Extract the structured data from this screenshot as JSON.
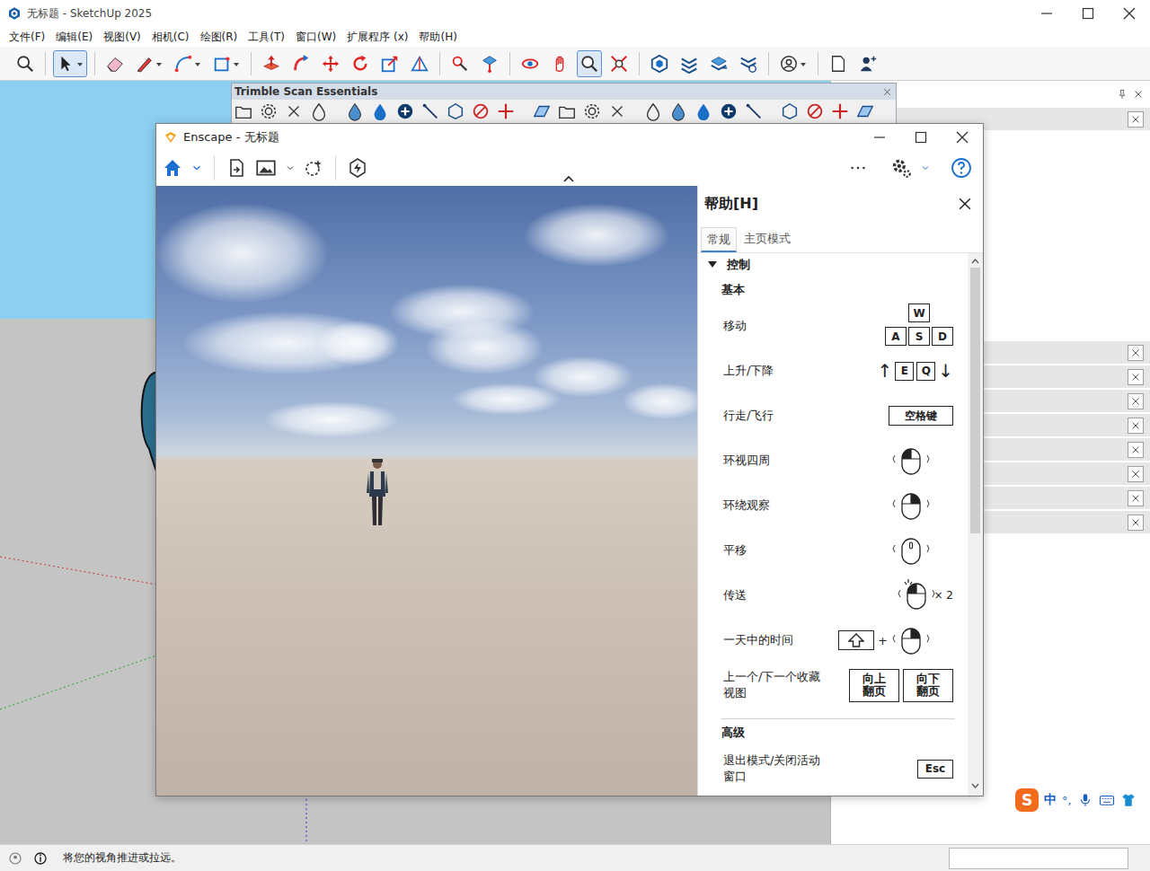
{
  "window": {
    "title": "无标题 - SketchUp 2025"
  },
  "menu": [
    "文件(F)",
    "编辑(E)",
    "视图(V)",
    "相机(C)",
    "绘图(R)",
    "工具(T)",
    "窗口(W)",
    "扩展程序 (x)",
    "帮助(H)"
  ],
  "toolbar": [
    {
      "selected": false
    },
    {
      "selected": true
    },
    {
      "selected": false
    },
    {
      "selected": false
    },
    {
      "selected": false
    },
    {
      "selected": false
    },
    {
      "selected": false
    },
    {
      "selected": false
    },
    {
      "selected": false
    },
    {
      "selected": false
    },
    {
      "selected": false
    },
    {
      "selected": false
    },
    {
      "selected": false
    },
    {
      "selected": false
    },
    {
      "selected": false
    },
    {
      "selected": false
    },
    {
      "selected": true
    },
    {
      "selected": false
    },
    {
      "selected": false
    },
    {
      "selected": false
    },
    {
      "selected": false
    },
    {
      "selected": false
    },
    {
      "selected": false
    },
    {
      "selected": false
    },
    {
      "selected": false
    }
  ],
  "scan_toolbar": {
    "title": "Trimble Scan Essentials"
  },
  "enscape": {
    "title": "Enscape - 无标题"
  },
  "help": {
    "title": "帮助[H]",
    "tabs": [
      {
        "label": "常规",
        "selected": true
      },
      {
        "label": "主页模式",
        "selected": false
      }
    ],
    "section": {
      "label": "控制",
      "expanded": true
    },
    "groups": [
      {
        "label": "基本",
        "rows": [
          {
            "label": "移动",
            "kind": "wasd",
            "keys": [
              "W",
              "A",
              "S",
              "D"
            ]
          },
          {
            "label": "上升/下降",
            "kind": "updown",
            "keys": [
              "E",
              "Q"
            ],
            "arrows": [
              "↑",
              "↓"
            ]
          },
          {
            "label": "行走/飞行",
            "kind": "keys",
            "keys": [
              "空格键"
            ]
          },
          {
            "label": "环视四周",
            "kind": "mouse",
            "button": "left"
          },
          {
            "label": "环绕观察",
            "kind": "mouse",
            "button": "right"
          },
          {
            "label": "平移",
            "kind": "mouse",
            "button": "middle"
          },
          {
            "label": "传送",
            "kind": "mouse",
            "button": "left",
            "suffix": "× 2"
          },
          {
            "label": "一天中的时间",
            "kind": "mouse",
            "button": "right",
            "modifier": "shift",
            "joiner": "+"
          },
          {
            "label": "上一个/下一个收藏视图",
            "kind": "keys",
            "keys": [
              "向上翻页",
              "向下翻页"
            ]
          }
        ]
      },
      {
        "label": "高级",
        "rows": [
          {
            "label": "退出模式/关闭活动窗口",
            "kind": "keys",
            "keys": [
              "Esc"
            ]
          }
        ]
      }
    ]
  },
  "status_bar": {
    "text": "将您的视角推进或拉远。"
  },
  "ime": {
    "logo": "S",
    "lang": "中",
    "punct": "°,"
  }
}
